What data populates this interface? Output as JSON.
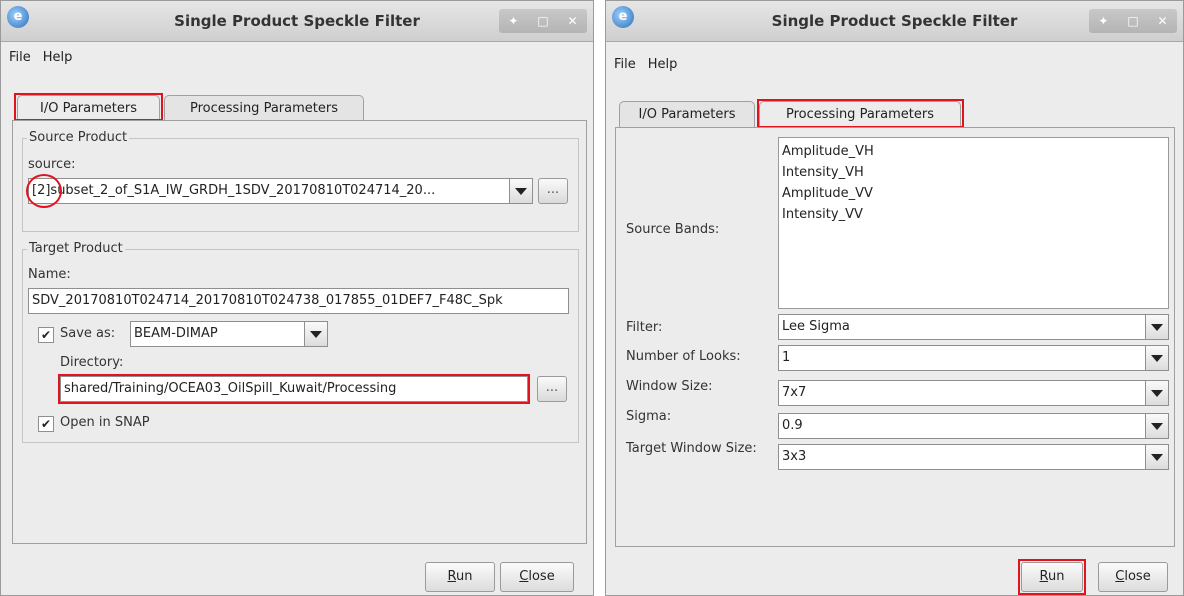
{
  "left_window": {
    "title": "Single Product Speckle Filter",
    "menu": [
      "File",
      "Help"
    ],
    "tabs": [
      "I/O Parameters",
      "Processing Parameters"
    ],
    "active_tab": "I/O Parameters",
    "source_product": {
      "group_title": "Source Product",
      "label": "source:",
      "index_tag": "[2]",
      "value": "subset_2_of_S1A_IW_GRDH_1SDV_20170810T024714_20...",
      "browse_label": "..."
    },
    "target_product": {
      "group_title": "Target Product",
      "name_label": "Name:",
      "name_value": "SDV_20170810T024714_20170810T024738_017855_01DEF7_F48C_Spk",
      "save_as_label": "Save as:",
      "save_as_checked": true,
      "format_value": "BEAM-DIMAP",
      "directory_label": "Directory:",
      "directory_value": "shared/Training/OCEA03_OilSpill_Kuwait/Processing",
      "browse_label": "...",
      "open_in_snap_label": "Open in SNAP",
      "open_in_snap_checked": true
    },
    "buttons": {
      "run_prefix": "R",
      "run_rest": "un",
      "close_prefix": "C",
      "close_rest": "lose"
    }
  },
  "right_window": {
    "title": "Single Product Speckle Filter",
    "menu": [
      "File",
      "Help"
    ],
    "tabs": [
      "I/O Parameters",
      "Processing Parameters"
    ],
    "active_tab": "Processing Parameters",
    "source_bands_label": "Source Bands:",
    "source_bands": [
      "Amplitude_VH",
      "Intensity_VH",
      "Amplitude_VV",
      "Intensity_VV"
    ],
    "params": [
      {
        "label": "Filter:",
        "value": "Lee Sigma"
      },
      {
        "label": "Number of Looks:",
        "value": "1"
      },
      {
        "label": "Window Size:",
        "value": "7x7"
      },
      {
        "label": "Sigma:",
        "value": "0.9"
      },
      {
        "label": "Target Window Size:",
        "value": "3x3"
      }
    ],
    "buttons": {
      "run_prefix": "R",
      "run_rest": "un",
      "close_prefix": "C",
      "close_rest": "lose"
    }
  },
  "icons": {
    "app": "snap-app-icon",
    "window_controls": [
      "pin-icon",
      "maximize-icon",
      "close-icon"
    ]
  },
  "colors": {
    "highlight": "#e0141f",
    "window_bg": "#ececec"
  }
}
